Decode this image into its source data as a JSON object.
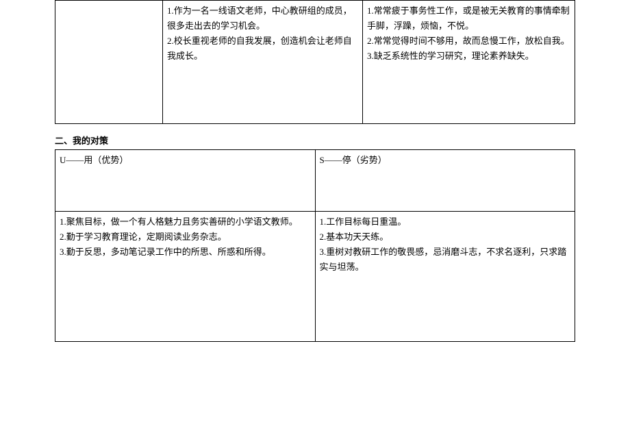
{
  "table1": {
    "col1": "",
    "col2": "1.作为一名一线语文老师，中心教研组的成员，很多走出去的学习机会。\n2.校长重视老师的自我发展，创造机会让老师自我成长。",
    "col3": "1.常常疲于事务性工作，或是被无关教育的事情牵制手脚，浮躁，烦恼，不悦。\n2.常常觉得时间不够用，故而怠慢工作，放松自我。\n3.缺乏系统性的学习研究，理论素养缺失。"
  },
  "section2_title": "二、我的对策",
  "table2": {
    "header": {
      "col1": "U——用（优势）",
      "col2": "S——停（劣势）"
    },
    "body": {
      "col1": "1.聚焦目标，做一个有人格魅力且务实善研的小学语文教师。\n2.勤于学习教育理论，定期阅读业务杂志。\n3.勤于反思，多动笔记录工作中的所思、所惑和所得。",
      "col2": "1.工作目标每日重温。\n2.基本功天天练。\n3.重树对教研工作的敬畏感，忌消磨斗志，不求名逐利，只求踏实与坦荡。"
    }
  }
}
